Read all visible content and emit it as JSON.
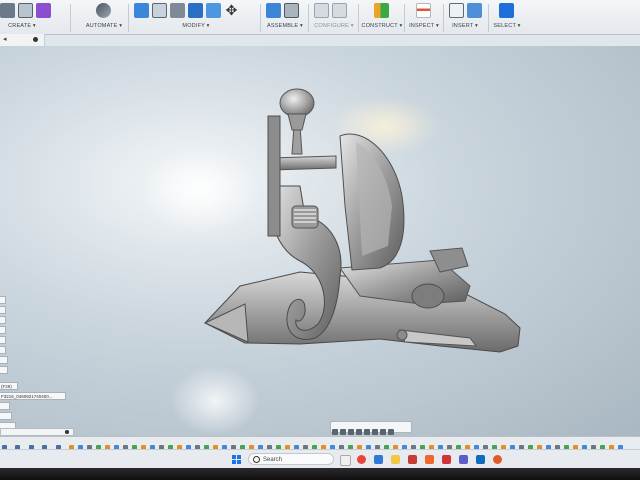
{
  "toolbar": {
    "groups": [
      {
        "id": "create",
        "label": "CREATE ▾"
      },
      {
        "id": "automate",
        "label": "AUTOMATE ▾"
      },
      {
        "id": "modify",
        "label": "MODIFY ▾"
      },
      {
        "id": "assemble",
        "label": "ASSEMBLE ▾"
      },
      {
        "id": "configure",
        "label": "CONFIGURE ▾"
      },
      {
        "id": "construct",
        "label": "CONSTRUCT ▾"
      },
      {
        "id": "inspect",
        "label": "INSPECT ▾"
      },
      {
        "id": "insert",
        "label": "INSERT ▾"
      },
      {
        "id": "select",
        "label": "SELECT ▾"
      }
    ]
  },
  "browser": {
    "items": [
      "",
      "",
      "",
      "",
      "",
      "",
      "",
      "",
      "(F29)",
      "F3216_0460921740400...",
      "",
      "",
      "",
      "",
      "",
      "",
      "",
      ""
    ]
  },
  "taskbar": {
    "search_placeholder": "Search"
  },
  "colors": {
    "accent": "#1a73e8",
    "viewport_bg": "#c4d0d9",
    "model_metal": "#9a9a9a"
  }
}
